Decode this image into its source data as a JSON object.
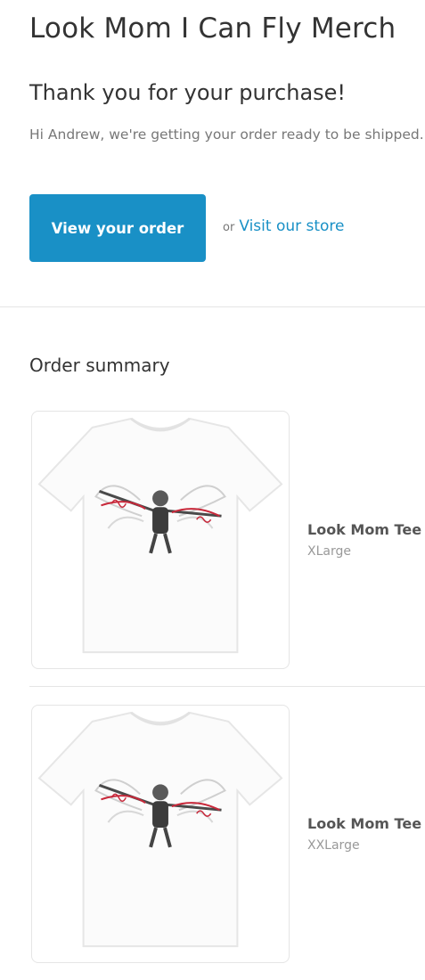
{
  "header": {
    "store_title": "Look Mom I Can Fly Merch"
  },
  "confirmation": {
    "heading": "Thank you for your purchase!",
    "message": "Hi Andrew, we're getting your order ready to be shipped. We will notify you when it has been sent.",
    "view_order_label": "View your order",
    "or_label": "or",
    "visit_store_label": "Visit our store"
  },
  "order_summary": {
    "heading": "Order summary",
    "items": [
      {
        "title": "Look Mom Tee",
        "variant": "XLarge",
        "image_icon": "tshirt-skeleton-print"
      },
      {
        "title": "Look Mom Tee",
        "variant": "XXLarge",
        "image_icon": "tshirt-skeleton-print"
      }
    ]
  },
  "colors": {
    "accent": "#1990c6",
    "text_primary": "#333333",
    "text_muted": "#777777",
    "divider": "#e5e5e5"
  }
}
